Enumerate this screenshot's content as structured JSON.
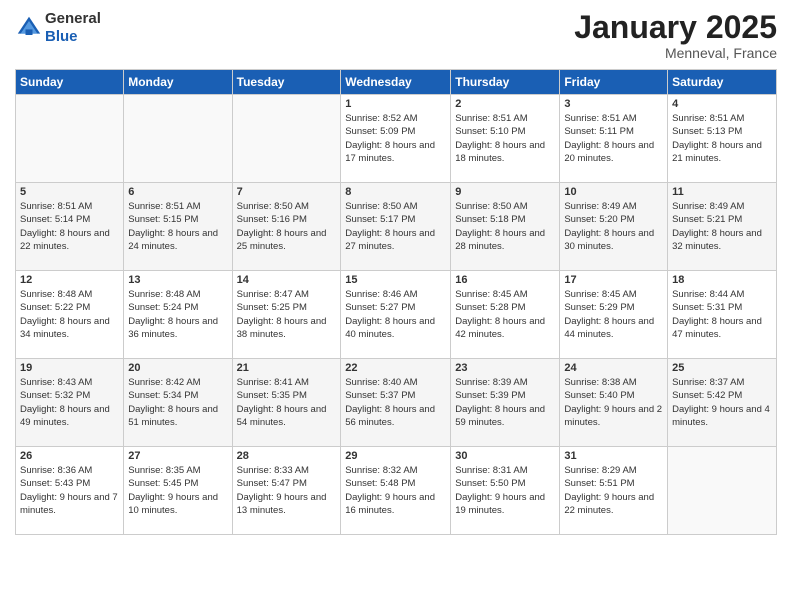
{
  "header": {
    "logo": {
      "text_general": "General",
      "text_blue": "Blue"
    },
    "month_title": "January 2025",
    "location": "Menneval, France"
  },
  "weekdays": [
    "Sunday",
    "Monday",
    "Tuesday",
    "Wednesday",
    "Thursday",
    "Friday",
    "Saturday"
  ],
  "weeks": [
    [
      {
        "day": "",
        "sunrise": "",
        "sunset": "",
        "daylight": ""
      },
      {
        "day": "",
        "sunrise": "",
        "sunset": "",
        "daylight": ""
      },
      {
        "day": "",
        "sunrise": "",
        "sunset": "",
        "daylight": ""
      },
      {
        "day": "1",
        "sunrise": "Sunrise: 8:52 AM",
        "sunset": "Sunset: 5:09 PM",
        "daylight": "Daylight: 8 hours and 17 minutes."
      },
      {
        "day": "2",
        "sunrise": "Sunrise: 8:51 AM",
        "sunset": "Sunset: 5:10 PM",
        "daylight": "Daylight: 8 hours and 18 minutes."
      },
      {
        "day": "3",
        "sunrise": "Sunrise: 8:51 AM",
        "sunset": "Sunset: 5:11 PM",
        "daylight": "Daylight: 8 hours and 20 minutes."
      },
      {
        "day": "4",
        "sunrise": "Sunrise: 8:51 AM",
        "sunset": "Sunset: 5:13 PM",
        "daylight": "Daylight: 8 hours and 21 minutes."
      }
    ],
    [
      {
        "day": "5",
        "sunrise": "Sunrise: 8:51 AM",
        "sunset": "Sunset: 5:14 PM",
        "daylight": "Daylight: 8 hours and 22 minutes."
      },
      {
        "day": "6",
        "sunrise": "Sunrise: 8:51 AM",
        "sunset": "Sunset: 5:15 PM",
        "daylight": "Daylight: 8 hours and 24 minutes."
      },
      {
        "day": "7",
        "sunrise": "Sunrise: 8:50 AM",
        "sunset": "Sunset: 5:16 PM",
        "daylight": "Daylight: 8 hours and 25 minutes."
      },
      {
        "day": "8",
        "sunrise": "Sunrise: 8:50 AM",
        "sunset": "Sunset: 5:17 PM",
        "daylight": "Daylight: 8 hours and 27 minutes."
      },
      {
        "day": "9",
        "sunrise": "Sunrise: 8:50 AM",
        "sunset": "Sunset: 5:18 PM",
        "daylight": "Daylight: 8 hours and 28 minutes."
      },
      {
        "day": "10",
        "sunrise": "Sunrise: 8:49 AM",
        "sunset": "Sunset: 5:20 PM",
        "daylight": "Daylight: 8 hours and 30 minutes."
      },
      {
        "day": "11",
        "sunrise": "Sunrise: 8:49 AM",
        "sunset": "Sunset: 5:21 PM",
        "daylight": "Daylight: 8 hours and 32 minutes."
      }
    ],
    [
      {
        "day": "12",
        "sunrise": "Sunrise: 8:48 AM",
        "sunset": "Sunset: 5:22 PM",
        "daylight": "Daylight: 8 hours and 34 minutes."
      },
      {
        "day": "13",
        "sunrise": "Sunrise: 8:48 AM",
        "sunset": "Sunset: 5:24 PM",
        "daylight": "Daylight: 8 hours and 36 minutes."
      },
      {
        "day": "14",
        "sunrise": "Sunrise: 8:47 AM",
        "sunset": "Sunset: 5:25 PM",
        "daylight": "Daylight: 8 hours and 38 minutes."
      },
      {
        "day": "15",
        "sunrise": "Sunrise: 8:46 AM",
        "sunset": "Sunset: 5:27 PM",
        "daylight": "Daylight: 8 hours and 40 minutes."
      },
      {
        "day": "16",
        "sunrise": "Sunrise: 8:45 AM",
        "sunset": "Sunset: 5:28 PM",
        "daylight": "Daylight: 8 hours and 42 minutes."
      },
      {
        "day": "17",
        "sunrise": "Sunrise: 8:45 AM",
        "sunset": "Sunset: 5:29 PM",
        "daylight": "Daylight: 8 hours and 44 minutes."
      },
      {
        "day": "18",
        "sunrise": "Sunrise: 8:44 AM",
        "sunset": "Sunset: 5:31 PM",
        "daylight": "Daylight: 8 hours and 47 minutes."
      }
    ],
    [
      {
        "day": "19",
        "sunrise": "Sunrise: 8:43 AM",
        "sunset": "Sunset: 5:32 PM",
        "daylight": "Daylight: 8 hours and 49 minutes."
      },
      {
        "day": "20",
        "sunrise": "Sunrise: 8:42 AM",
        "sunset": "Sunset: 5:34 PM",
        "daylight": "Daylight: 8 hours and 51 minutes."
      },
      {
        "day": "21",
        "sunrise": "Sunrise: 8:41 AM",
        "sunset": "Sunset: 5:35 PM",
        "daylight": "Daylight: 8 hours and 54 minutes."
      },
      {
        "day": "22",
        "sunrise": "Sunrise: 8:40 AM",
        "sunset": "Sunset: 5:37 PM",
        "daylight": "Daylight: 8 hours and 56 minutes."
      },
      {
        "day": "23",
        "sunrise": "Sunrise: 8:39 AM",
        "sunset": "Sunset: 5:39 PM",
        "daylight": "Daylight: 8 hours and 59 minutes."
      },
      {
        "day": "24",
        "sunrise": "Sunrise: 8:38 AM",
        "sunset": "Sunset: 5:40 PM",
        "daylight": "Daylight: 9 hours and 2 minutes."
      },
      {
        "day": "25",
        "sunrise": "Sunrise: 8:37 AM",
        "sunset": "Sunset: 5:42 PM",
        "daylight": "Daylight: 9 hours and 4 minutes."
      }
    ],
    [
      {
        "day": "26",
        "sunrise": "Sunrise: 8:36 AM",
        "sunset": "Sunset: 5:43 PM",
        "daylight": "Daylight: 9 hours and 7 minutes."
      },
      {
        "day": "27",
        "sunrise": "Sunrise: 8:35 AM",
        "sunset": "Sunset: 5:45 PM",
        "daylight": "Daylight: 9 hours and 10 minutes."
      },
      {
        "day": "28",
        "sunrise": "Sunrise: 8:33 AM",
        "sunset": "Sunset: 5:47 PM",
        "daylight": "Daylight: 9 hours and 13 minutes."
      },
      {
        "day": "29",
        "sunrise": "Sunrise: 8:32 AM",
        "sunset": "Sunset: 5:48 PM",
        "daylight": "Daylight: 9 hours and 16 minutes."
      },
      {
        "day": "30",
        "sunrise": "Sunrise: 8:31 AM",
        "sunset": "Sunset: 5:50 PM",
        "daylight": "Daylight: 9 hours and 19 minutes."
      },
      {
        "day": "31",
        "sunrise": "Sunrise: 8:29 AM",
        "sunset": "Sunset: 5:51 PM",
        "daylight": "Daylight: 9 hours and 22 minutes."
      },
      {
        "day": "",
        "sunrise": "",
        "sunset": "",
        "daylight": ""
      }
    ]
  ]
}
